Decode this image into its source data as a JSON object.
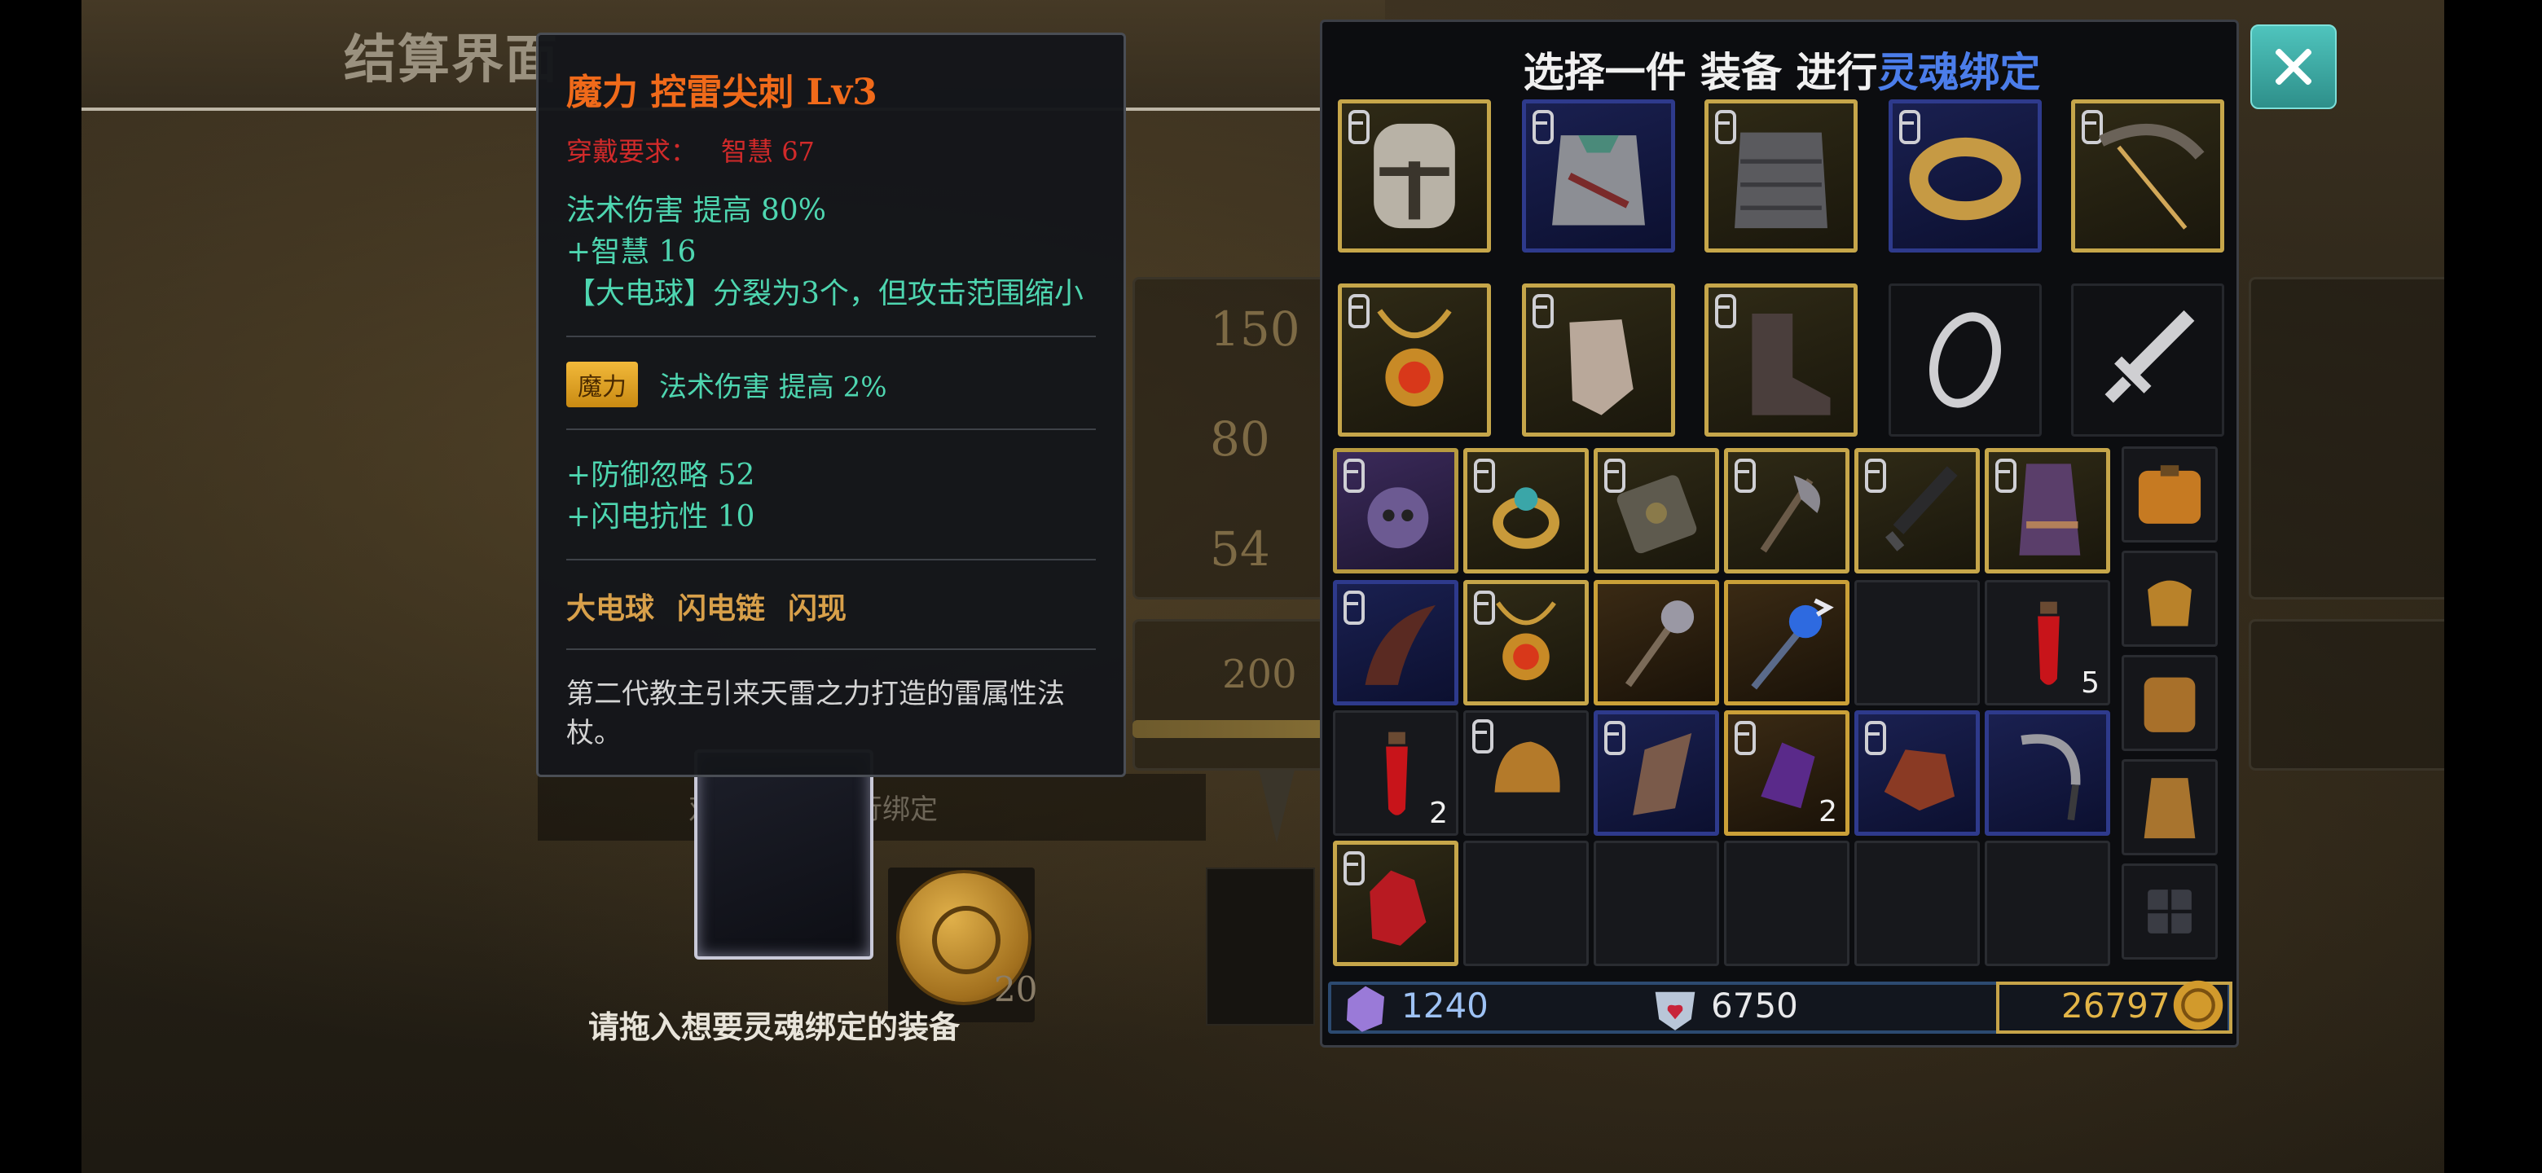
{
  "page_title": "结算界面",
  "background": {
    "values": [
      "150",
      "80",
      "54",
      "200"
    ],
    "hint": "双击或拖拽进行绑定",
    "drop_label": "请拖入想要灵魂绑定的装备",
    "coin_count": "20"
  },
  "tooltip": {
    "name": "魔力 控雷尖刺 Lv3",
    "requirement_label": "穿戴要求：",
    "requirement_value": "智慧 67",
    "stats": [
      "法术伤害 提高 80%",
      "+智慧 16",
      "【大电球】分裂为3个，但攻击范围缩小"
    ],
    "tag": "魔力",
    "tag_stat": "法术伤害 提高 2%",
    "bonus": [
      "+防御忽略 52",
      "+闪电抗性 10"
    ],
    "skills": [
      "大电球",
      "闪电链",
      "闪现"
    ],
    "description": "第二代教主引来天雷之力打造的雷属性法杖。"
  },
  "inventory": {
    "title_prefix": "选择一件 装备 进行",
    "title_highlight": "灵魂绑定",
    "equipped": [
      {
        "name": "helmet-icon",
        "rarity": "gold"
      },
      {
        "name": "chest-armor-icon",
        "rarity": "blue"
      },
      {
        "name": "chainmail-icon",
        "rarity": "gold"
      },
      {
        "name": "bracelet-icon",
        "rarity": "blue"
      },
      {
        "name": "bow-icon",
        "rarity": "gold"
      },
      {
        "name": "amulet-icon",
        "rarity": "gold"
      },
      {
        "name": "gloves-icon",
        "rarity": "gold"
      },
      {
        "name": "boots-icon",
        "rarity": "gold"
      },
      {
        "name": "ring-slot-icon",
        "rarity": "empty"
      },
      {
        "name": "weapon-slot-icon",
        "rarity": "empty"
      }
    ],
    "bag_counts": {
      "potion_a": "5",
      "potion_b": "2",
      "crystal": "2"
    },
    "currency": {
      "crystals": "1240",
      "hearts": "6750",
      "gold": "26797"
    }
  },
  "colors": {
    "accent_blue": "#4b7dea",
    "item_name": "#f06a1a",
    "stat_text": "#4ed6b0",
    "requirement": "#d12a2a",
    "skill_text": "#d8a04a"
  }
}
